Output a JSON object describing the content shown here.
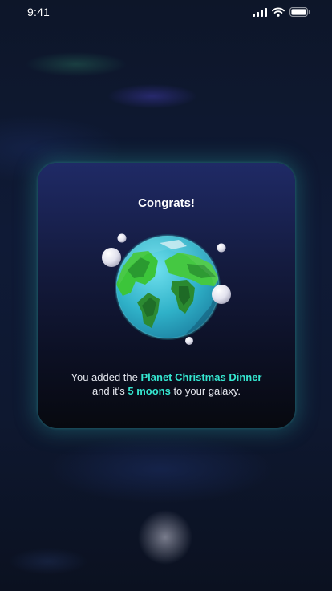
{
  "status_bar": {
    "time": "9:41",
    "icons": [
      "signal-icon",
      "wifi-icon",
      "battery-icon"
    ]
  },
  "modal": {
    "title": "Congrats!",
    "illustration": "planet-earth-with-moons",
    "message": {
      "part1": "You added the ",
      "planet_name": "Planet Christmas Dinner",
      "part2": "and it's ",
      "moons": "5 moons",
      "part3": " to your galaxy."
    }
  },
  "colors": {
    "accent": "#35e6d0",
    "background": "#0c1426",
    "card_top": "#1f2a66",
    "card_bottom": "#07090f"
  }
}
